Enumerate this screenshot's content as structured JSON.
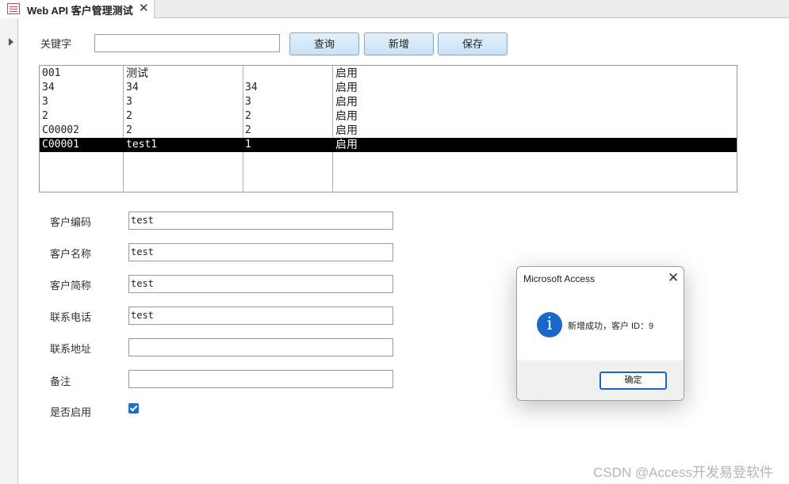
{
  "tab": {
    "title": "Web API 客户管理测试",
    "close": "✕"
  },
  "search": {
    "label": "关键字",
    "value": ""
  },
  "buttons": {
    "query": "查询",
    "add": "新增",
    "save": "保存"
  },
  "list": {
    "rows": [
      [
        "001",
        "测试",
        "",
        "启用"
      ],
      [
        "34",
        "34",
        "34",
        "启用"
      ],
      [
        "3",
        "3",
        "3",
        "启用"
      ],
      [
        "2",
        "2",
        "2",
        "启用"
      ],
      [
        "C00002",
        "2",
        "2",
        "启用"
      ],
      [
        "C00001",
        "test1",
        "1",
        "启用"
      ]
    ],
    "selected_row": 5
  },
  "fields": {
    "code": {
      "label": "客户编码",
      "value": "test"
    },
    "name": {
      "label": "客户名称",
      "value": "test"
    },
    "short_name": {
      "label": "客户简称",
      "value": "test"
    },
    "phone": {
      "label": "联系电话",
      "value": "test"
    },
    "address": {
      "label": "联系地址",
      "value": ""
    },
    "remark": {
      "label": "备注",
      "value": ""
    },
    "enabled": {
      "label": "是否启用",
      "checked": true
    }
  },
  "dialog": {
    "title": "Microsoft Access",
    "close": "✕",
    "icon": "i",
    "message": "新增成功，客户 ID：9",
    "ok_label": "确定"
  },
  "watermark": "CSDN @Access开发易登软件"
}
